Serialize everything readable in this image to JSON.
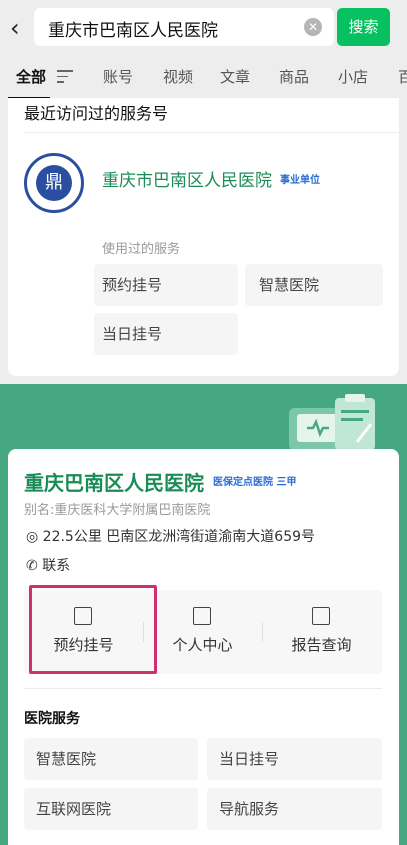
{
  "search": {
    "query": "重庆市巴南区人民医院",
    "clear_icon": "clear-icon",
    "button": "搜索"
  },
  "tabs": [
    "全部",
    "账号",
    "视频",
    "文章",
    "商品",
    "小店",
    "百"
  ],
  "recent": {
    "title": "最近访问过的服务号",
    "account_name": "重庆市巴南区人民医院",
    "account_tag": "事业单位",
    "used_label": "使用过的服务",
    "services": [
      "预约挂号",
      "智慧医院",
      "当日挂号"
    ]
  },
  "hospital": {
    "name": "重庆巴南区人民医院",
    "tags": "医保定点医院 三甲",
    "alias": "别名:重庆医科大学附属巴南医院",
    "address": "22.5公里 巴南区龙洲湾街道渝南大道659号",
    "contact": "联系",
    "quick_actions": [
      "预约挂号",
      "个人中心",
      "报告查询"
    ],
    "services_title": "医院服务",
    "services": [
      "智慧医院",
      "当日挂号",
      "互联网医院",
      "导航服务"
    ]
  },
  "colors": {
    "accent": "#07c160",
    "brand_green": "#1a8c56",
    "header_green": "#46a883",
    "highlight": "#d0306f",
    "tag_blue": "#2b6dd1"
  }
}
